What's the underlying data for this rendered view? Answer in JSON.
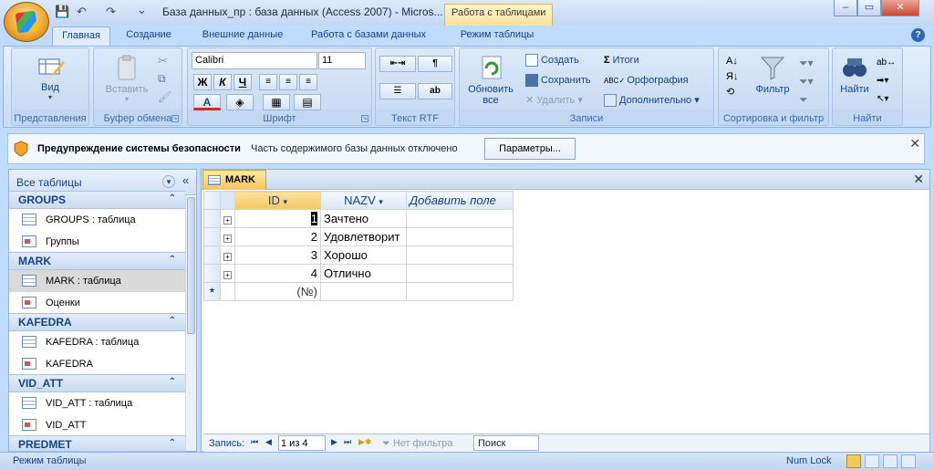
{
  "window": {
    "title": "База данных_пр : база данных (Access 2007) - Micros...",
    "contextual_tab": "Работа с таблицами",
    "controls": [
      "–",
      "▭",
      "✕"
    ]
  },
  "qat": {
    "save": "💾",
    "undo": "↶",
    "redo": "↷",
    "customize": "⌄"
  },
  "ribbon_tabs": [
    "Главная",
    "Создание",
    "Внешние данные",
    "Работа с базами данных",
    "Режим таблицы"
  ],
  "help": "?",
  "ribbon": {
    "view": {
      "label": "Вид",
      "group": "Представления"
    },
    "clipboard": {
      "paste": "Вставить",
      "group": "Буфер обмена"
    },
    "font": {
      "name": "Calibri",
      "size": "11",
      "bold": "Ж",
      "italic": "К",
      "underline": "Ч",
      "color": "A",
      "group": "Шрифт"
    },
    "rtf": {
      "group": "Текст RTF"
    },
    "records": {
      "refresh": "Обновить все",
      "create": "Создать",
      "save": "Сохранить",
      "delete": "Удалить",
      "totals": "Итоги",
      "spelling": "Орфография",
      "more": "Дополнительно",
      "group": "Записи"
    },
    "sort": {
      "filter": "Фильтр",
      "group": "Сортировка и фильтр"
    },
    "find": {
      "find": "Найти",
      "group": "Найти"
    }
  },
  "security": {
    "title": "Предупреждение системы безопасности",
    "message": "Часть содержимого базы данных отключено",
    "button": "Параметры..."
  },
  "nav": {
    "title": "Все таблицы",
    "sections": [
      {
        "name": "GROUPS",
        "items": [
          "GROUPS : таблица",
          "Группы"
        ]
      },
      {
        "name": "MARK",
        "items": [
          "MARK : таблица",
          "Оценки"
        ]
      },
      {
        "name": "KAFEDRA",
        "items": [
          "KAFEDRA : таблица",
          "KAFEDRA"
        ]
      },
      {
        "name": "VID_ATT",
        "items": [
          "VID_ATT : таблица",
          "VID_ATT"
        ]
      },
      {
        "name": "PREDMET",
        "items": []
      }
    ]
  },
  "document": {
    "tab": "MARK",
    "columns": [
      "ID",
      "NAZV",
      "Добавить поле"
    ],
    "rows": [
      {
        "id": "1",
        "nazv": "Зачтено"
      },
      {
        "id": "2",
        "nazv": "Удовлетворит"
      },
      {
        "id": "3",
        "nazv": "Хорошо"
      },
      {
        "id": "4",
        "nazv": "Отлично"
      }
    ],
    "new_row_marker": "*",
    "new_row_id": "(№)",
    "record_bar": {
      "label": "Запись:",
      "position": "1 из 4",
      "filter": "Нет фильтра",
      "search": "Поиск"
    }
  },
  "status": {
    "left": "Режим таблицы",
    "numlock": "Num Lock"
  }
}
